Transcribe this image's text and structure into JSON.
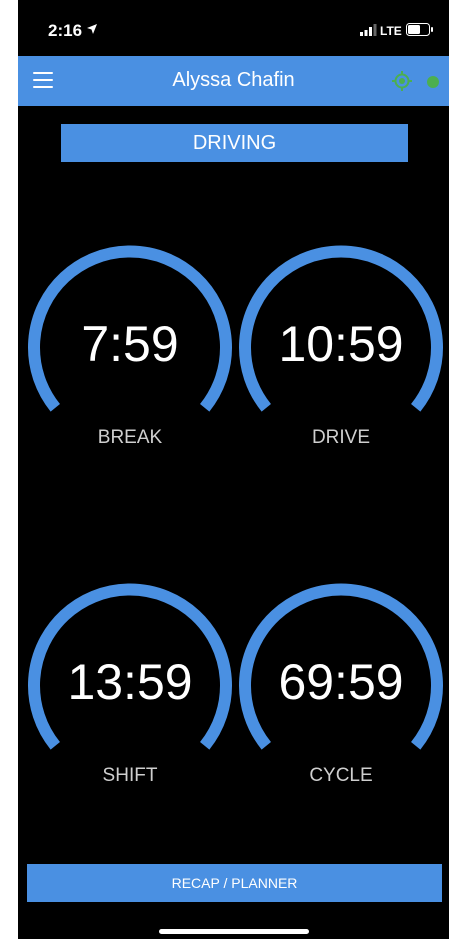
{
  "status_bar": {
    "time": "2:16",
    "network": "LTE"
  },
  "header": {
    "title": "Alyssa Chafin"
  },
  "status_button": {
    "label": "DRIVING"
  },
  "gauges": [
    {
      "value": "7:59",
      "label": "BREAK"
    },
    {
      "value": "10:59",
      "label": "DRIVE"
    },
    {
      "value": "13:59",
      "label": "SHIFT"
    },
    {
      "value": "69:59",
      "label": "CYCLE"
    }
  ],
  "recap_button": {
    "label": "RECAP / PLANNER"
  },
  "colors": {
    "accent": "#4a90e2",
    "online": "#4caf50",
    "background": "#000000"
  }
}
